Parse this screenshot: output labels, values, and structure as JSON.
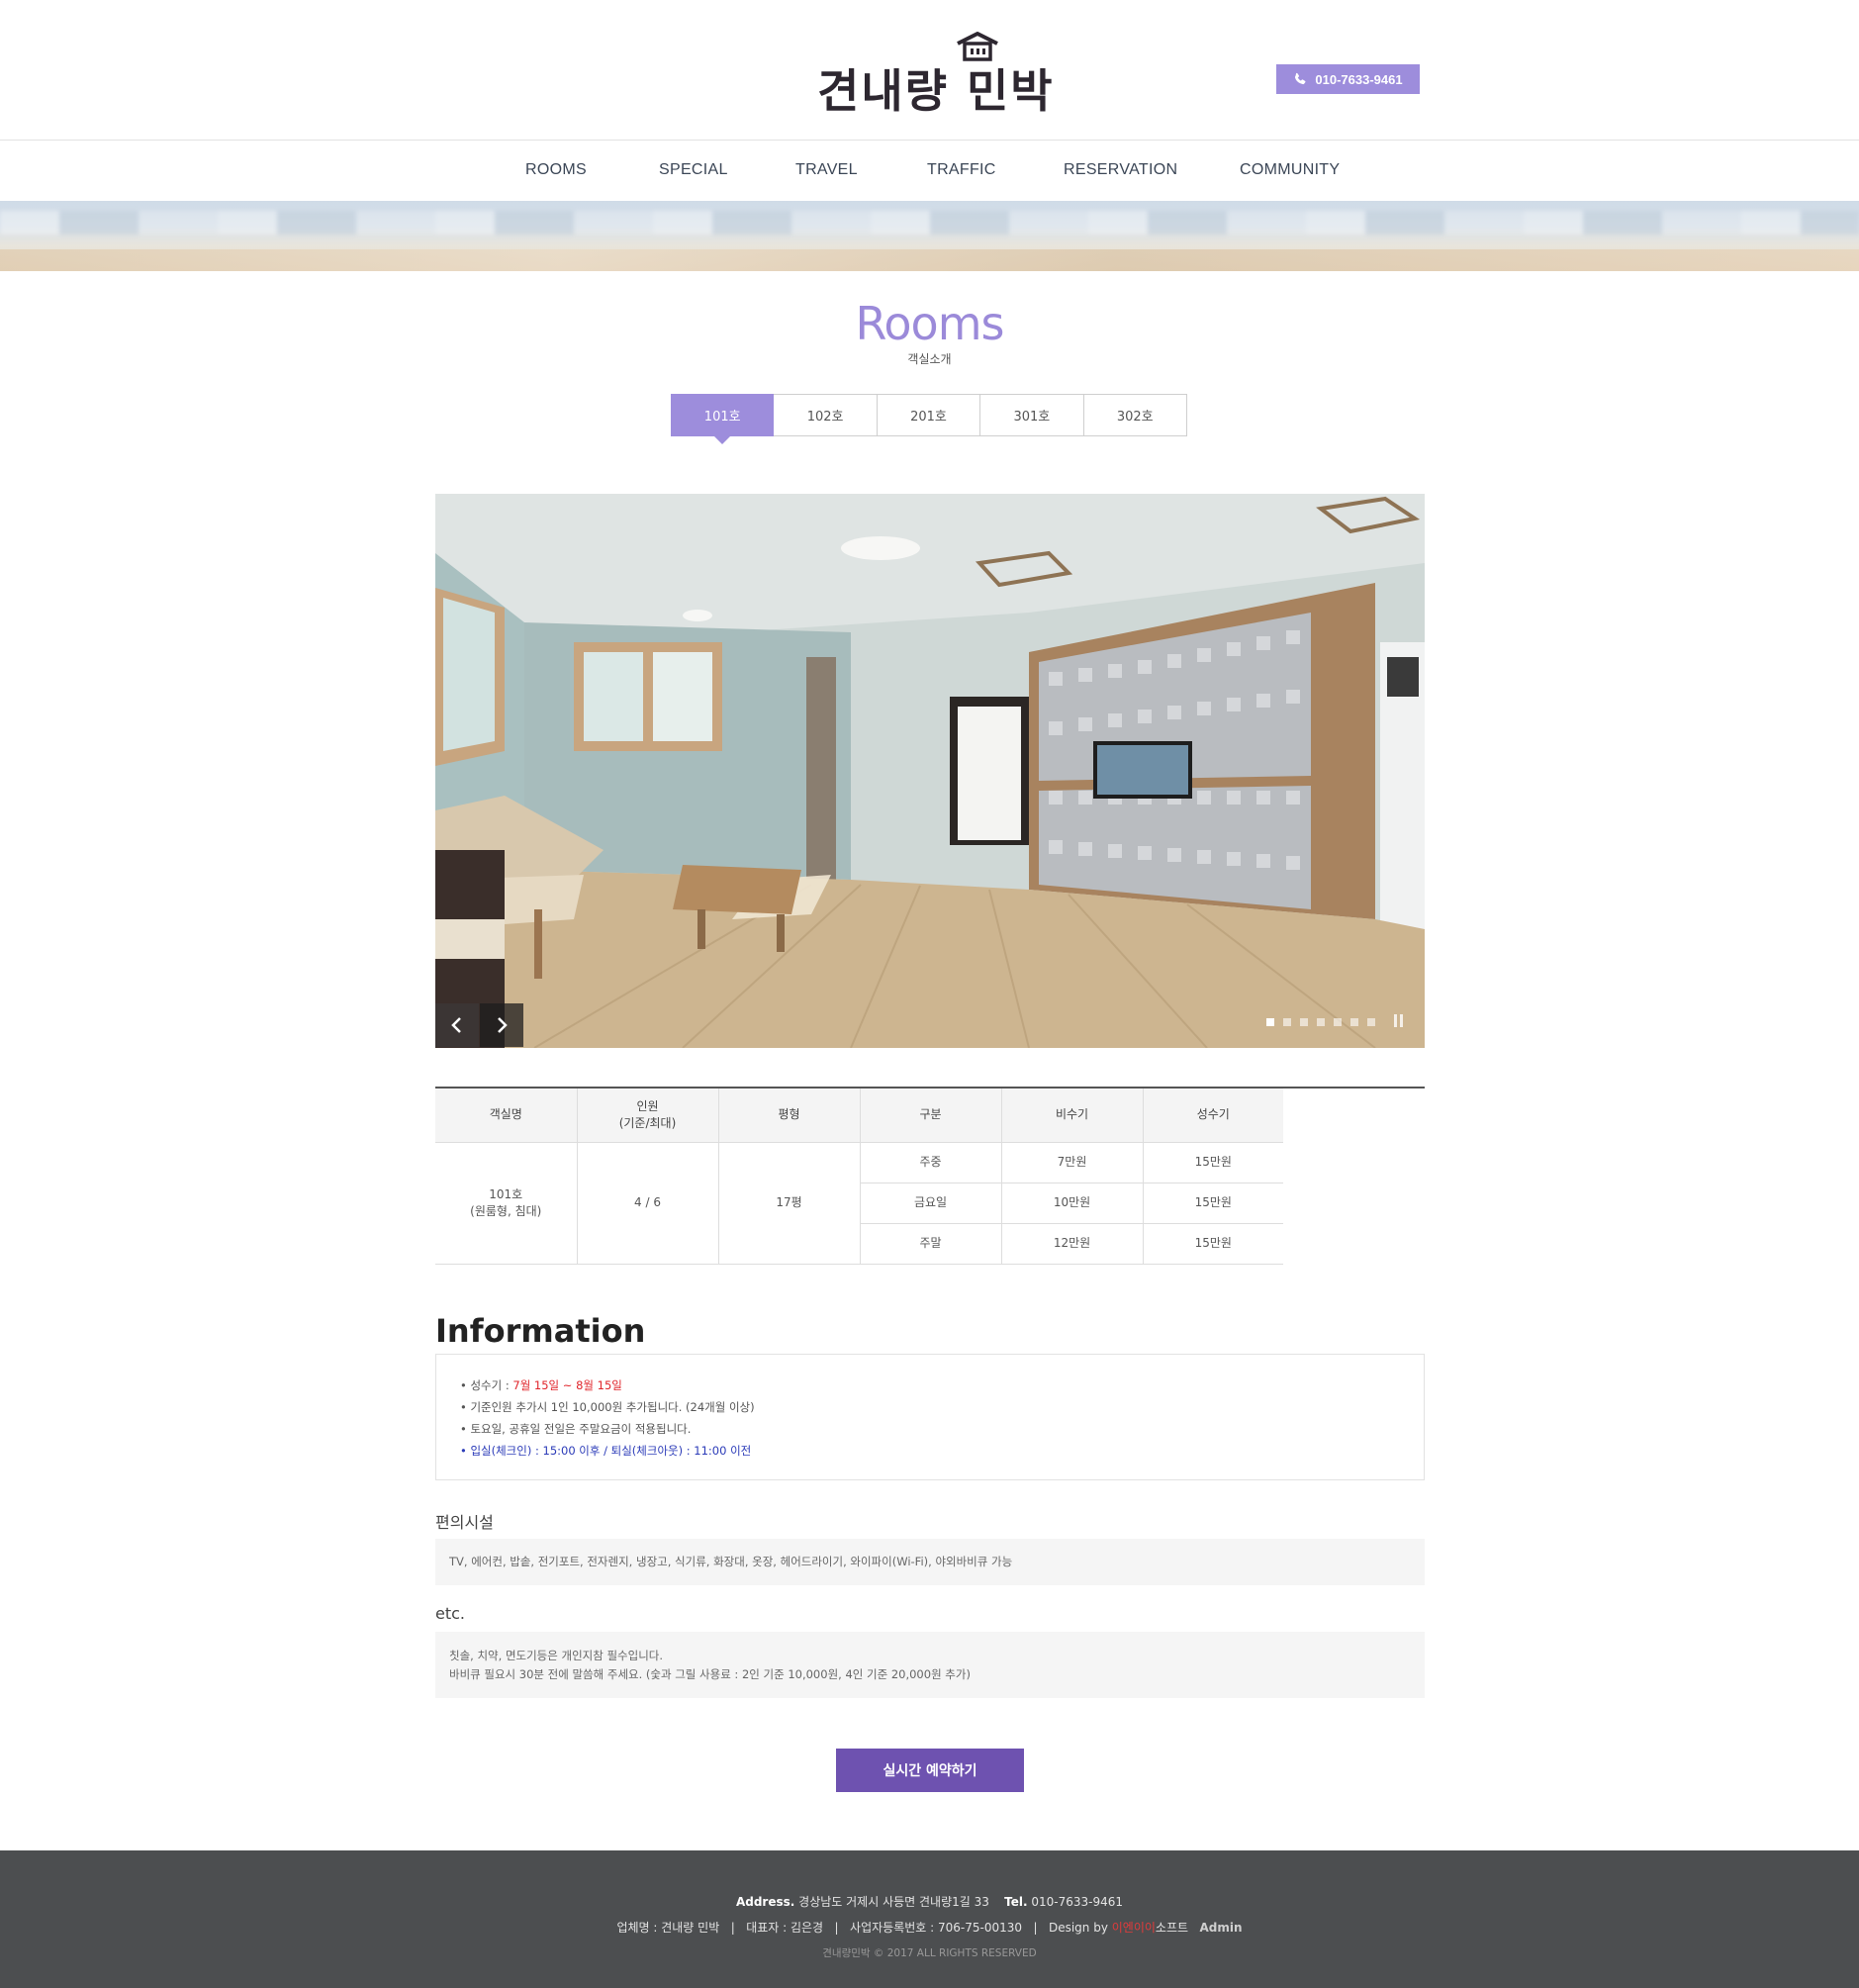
{
  "header": {
    "logo_text": "견내량 민박",
    "phone": "010-7633-9461"
  },
  "nav": {
    "items": [
      "ROOMS",
      "SPECIAL",
      "TRAVEL",
      "TRAFFIC",
      "RESERVATION",
      "COMMUNITY"
    ]
  },
  "page": {
    "title": "Rooms",
    "subtitle": "객실소개"
  },
  "tabs": [
    {
      "label": "101호",
      "active": true
    },
    {
      "label": "102호",
      "active": false
    },
    {
      "label": "201호",
      "active": false
    },
    {
      "label": "301호",
      "active": false
    },
    {
      "label": "302호",
      "active": false
    }
  ],
  "slider": {
    "dot_count": 7,
    "active_index": 0
  },
  "room_table": {
    "headers": [
      "객실명",
      "인원\n(기준/최대)",
      "평형",
      "구분",
      "비수기",
      "성수기"
    ],
    "room_name": "101호",
    "room_type": "(원룸형, 침대)",
    "capacity": "4 / 6",
    "size": "17평",
    "rows": [
      {
        "period": "주중",
        "off_season": "7만원",
        "peak_season": "15만원"
      },
      {
        "period": "금요일",
        "off_season": "10만원",
        "peak_season": "15만원"
      },
      {
        "period": "주말",
        "off_season": "12만원",
        "peak_season": "15만원"
      }
    ]
  },
  "information": {
    "title": "Information",
    "line1_label": "• 성수기 : ",
    "line1_value": "7월 15일 ~ 8월 15일",
    "line2": "• 기준인원 추가시 1인 10,000원 추가됩니다. (24개월 이상)",
    "line3": "• 토요일, 공휴일 전일은 주말요금이 적용됩니다.",
    "line4": "• 입실(체크인) : 15:00 이후 / 퇴실(체크아웃) : 11:00 이전"
  },
  "amenities": {
    "title": "편의시설",
    "text": "TV, 에어컨, 밥솥, 전기포트, 전자렌지, 냉장고, 식기류, 화장대, 옷장, 헤어드라이기, 와이파이(Wi-Fi), 야외바비큐 가능"
  },
  "etc": {
    "title": "etc.",
    "line1": "칫솔, 치약, 면도기등은 개인지참 필수입니다.",
    "line2": "바비큐 필요시 30분 전에 말씀해 주세요. (숯과 그릴 사용료 : 2인 기준 10,000원, 4인 기준 20,000원 추가)"
  },
  "reserve_button": "실시간 예약하기",
  "footer": {
    "address_label": "Address.",
    "address": "경상남도 거제시 사등면 견내량1길 33",
    "tel_label": "Tel.",
    "tel": "010-7633-9461",
    "company": "업체명 : 견내량 민박",
    "ceo": "대표자 : 김은경",
    "biz_no": "사업자등록번호 : 706-75-00130",
    "design_label": "Design by",
    "design_red": "이엔이이",
    "design_rest": "소프트",
    "admin": "Admin",
    "copyright": "견내량민박 © 2017 ALL RIGHTS RESERVED"
  },
  "colors": {
    "accent": "#9d8ddc",
    "button": "#6e52b0",
    "footer_bg": "#4c4e50",
    "red": "#e0242a",
    "blue": "#2b3bb8"
  }
}
